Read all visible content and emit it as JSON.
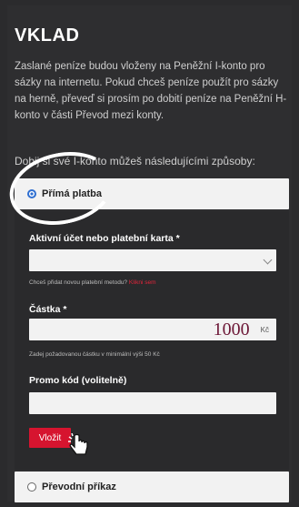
{
  "page": {
    "title": "VKLAD",
    "intro": "Zaslané peníze budou vloženy na Peněžní I-konto pro sázky na internetu. Pokud chceš peníze použít pro sázky na herně, převeď si prosím po dobití peníze na Peněžní H-konto v části Převod mezi konty.",
    "methods_heading": "Dobij si své I-konto můžeš následujícími způsoby:"
  },
  "payment_methods": [
    {
      "label": "Přímá platba",
      "selected": true
    },
    {
      "label": "Převodní příkaz",
      "selected": false
    }
  ],
  "form": {
    "account_label": "Aktivní účet nebo platební karta *",
    "account_value": "",
    "add_method_text": "Chceš přidat novou platební metodu?",
    "add_method_link": "Klikni sem",
    "amount_label": "Částka *",
    "amount_value": "1000",
    "amount_unit": "Kč",
    "amount_hint": "Zadej požadovanou částku v minimální výši 50 Kč",
    "promo_label": "Promo kód (volitelně)",
    "promo_value": "",
    "submit_label": "Vložit"
  },
  "colors": {
    "accent": "#d6142f",
    "radio": "#2f6fd1",
    "amount_text": "#6b1535"
  },
  "icons": {
    "select_arrow": "chevron-down-icon",
    "cursor": "hand-pointer-icon"
  }
}
